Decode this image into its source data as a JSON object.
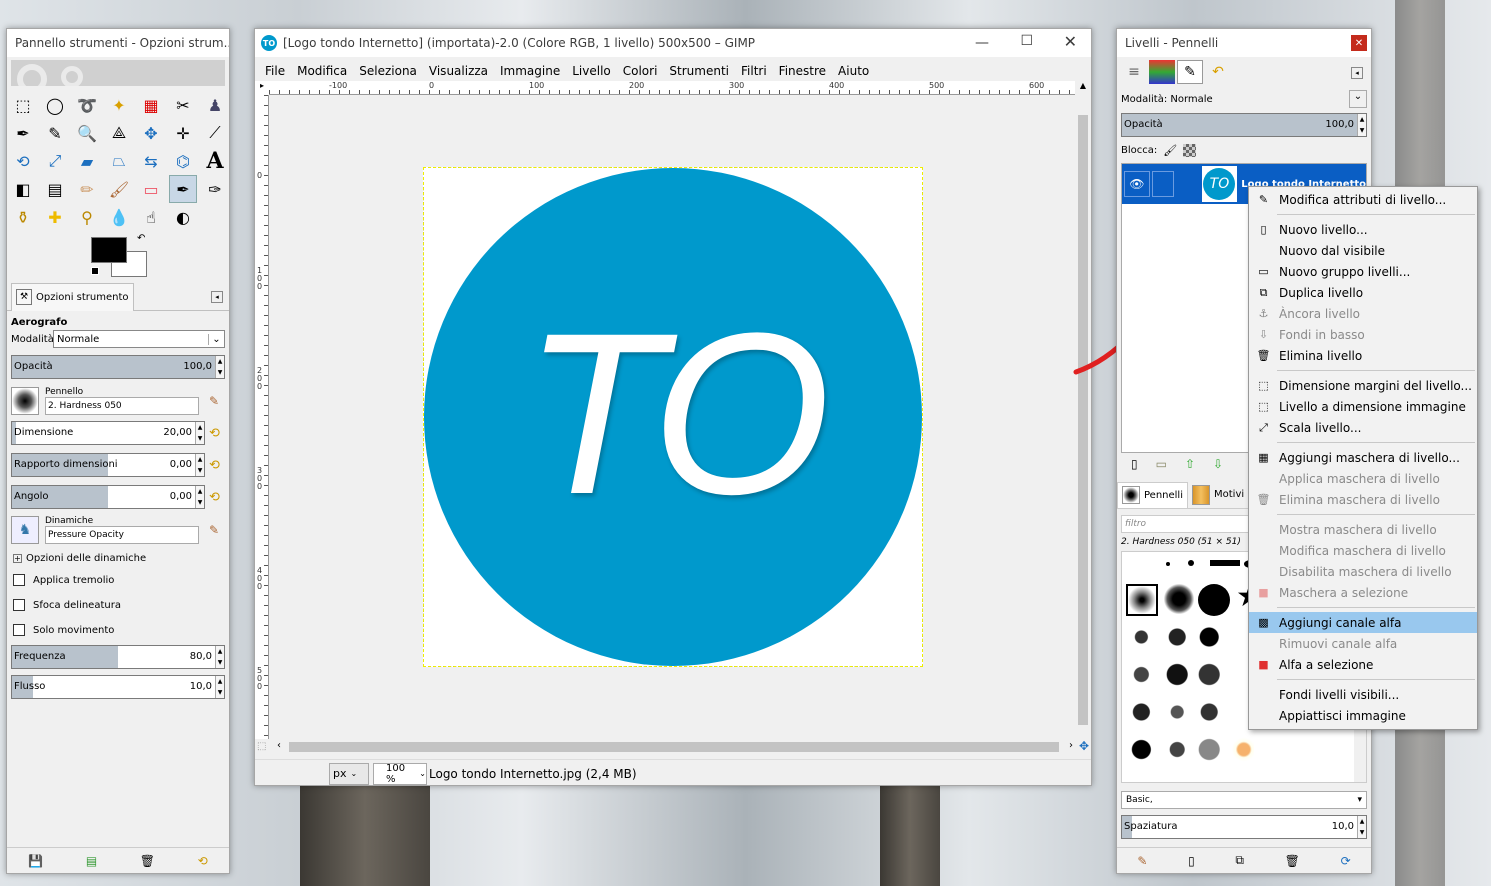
{
  "toolbox": {
    "title": "Pannello strumenti - Opzioni strum...",
    "tab_label": "Opzioni strumento",
    "tool_name": "Aerografo",
    "mode_label": "Modalità:",
    "mode_value": "Normale",
    "opacity_label": "Opacità",
    "opacity_value": "100,0",
    "brush_label": "Pennello",
    "brush_value": "2. Hardness 050",
    "size_label": "Dimensione",
    "size_value": "20,00",
    "ratio_label": "Rapporto dimensioni",
    "ratio_value": "0,00",
    "angle_label": "Angolo",
    "angle_value": "0,00",
    "dynamics_label": "Dinamiche",
    "dynamics_value": "Pressure Opacity",
    "dynamics_options": "Opzioni delle dinamiche",
    "chk_jitter": "Applica tremolio",
    "chk_smooth": "Sfoca delineatura",
    "chk_incremental": "Solo movimento",
    "rate_label": "Frequenza",
    "rate_value": "80,0",
    "flow_label": "Flusso",
    "flow_value": "10,0"
  },
  "main": {
    "title": "[Logo tondo Internetto] (importata)-2.0 (Colore RGB, 1 livello) 500x500 – GIMP",
    "app_icon_text": "TO",
    "menu": [
      "File",
      "Modifica",
      "Seleziona",
      "Visualizza",
      "Immagine",
      "Livello",
      "Colori",
      "Strumenti",
      "Filtri",
      "Finestre",
      "Aiuto"
    ],
    "ruler_h": [
      "-100",
      "0",
      "100",
      "200",
      "300",
      "400",
      "500",
      "600"
    ],
    "ruler_v": [
      "0",
      "1 0 0",
      "2 0 0",
      "3 0 0",
      "4 0 0",
      "5 0 0"
    ],
    "logo_text": "TO",
    "unit": "px",
    "zoom": "100 %",
    "status": "Logo tondo Internetto.jpg (2,4 MB)"
  },
  "layers": {
    "title": "Livelli - Pennelli",
    "mode_label": "Modalità: Normale",
    "opacity_label": "Opacità",
    "opacity_value": "100,0",
    "lock_label": "Blocca:",
    "layer_thumb_text": "TO",
    "layer_name": "Logo tondo Internetto",
    "tab_brushes": "Pennelli",
    "tab_patterns": "Motivi",
    "filter_placeholder": "filtro",
    "brush_name": "2. Hardness 050 (51 × 51)",
    "preset": "Basic,",
    "spacing_label": "Spaziatura",
    "spacing_value": "10,0"
  },
  "context_menu": [
    {
      "label": "Modifica attributi di livello...",
      "icon": "✎",
      "disabled": false
    },
    {
      "sep": true
    },
    {
      "label": "Nuovo livello...",
      "icon": "▯",
      "disabled": false
    },
    {
      "label": "Nuovo dal visibile",
      "icon": "",
      "disabled": false
    },
    {
      "label": "Nuovo gruppo livelli...",
      "icon": "▭",
      "disabled": false
    },
    {
      "label": "Duplica livello",
      "icon": "⧉",
      "disabled": false
    },
    {
      "label": "Àncora livello",
      "icon": "⚓",
      "disabled": true
    },
    {
      "label": "Fondi in basso",
      "icon": "⇩",
      "disabled": true
    },
    {
      "label": "Elimina livello",
      "icon": "🗑",
      "disabled": false
    },
    {
      "sep": true
    },
    {
      "label": "Dimensione margini del livello...",
      "icon": "⬚",
      "disabled": false
    },
    {
      "label": "Livello a dimensione immagine",
      "icon": "⬚",
      "disabled": false
    },
    {
      "label": "Scala livello...",
      "icon": "⤢",
      "disabled": false
    },
    {
      "sep": true
    },
    {
      "label": "Aggiungi maschera di livello...",
      "icon": "▦",
      "disabled": false
    },
    {
      "label": "Applica maschera di livello",
      "icon": "",
      "disabled": true
    },
    {
      "label": "Elimina maschera di livello",
      "icon": "🗑",
      "disabled": true
    },
    {
      "sep": true
    },
    {
      "label": "Mostra maschera di livello",
      "icon": "",
      "disabled": true
    },
    {
      "label": "Modifica maschera di livello",
      "icon": "",
      "disabled": true
    },
    {
      "label": "Disabilita maschera di livello",
      "icon": "",
      "disabled": true
    },
    {
      "label": "Maschera a selezione",
      "icon": "■",
      "disabled": true
    },
    {
      "sep": true
    },
    {
      "label": "Aggiungi canale alfa",
      "icon": "▩",
      "disabled": false,
      "highlight": true
    },
    {
      "label": "Rimuovi canale alfa",
      "icon": "",
      "disabled": true
    },
    {
      "label": "Alfa a selezione",
      "icon": "■",
      "disabled": false
    },
    {
      "sep": true
    },
    {
      "label": "Fondi livelli visibili...",
      "icon": "",
      "disabled": false
    },
    {
      "label": "Appiattisci immagine",
      "icon": "",
      "disabled": false
    }
  ],
  "colors": {
    "logo_blue": "#0099cc",
    "selection_blue": "#0a5ec4",
    "highlight": "#99c8ee",
    "annotation_red": "#e02020"
  }
}
